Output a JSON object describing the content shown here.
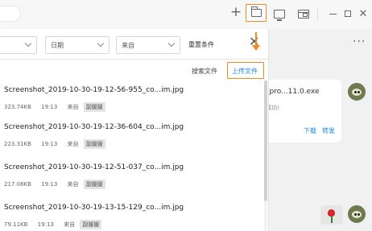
{
  "topbar": {
    "icons": [
      "plus-icon",
      "folder-icon",
      "screen-icon",
      "box-icon",
      "minimize-icon",
      "maximize-icon",
      "close-icon"
    ],
    "plus_glyph": "+",
    "close_glyph": "✕"
  },
  "filters": {
    "first_value": "",
    "date_label": "日期",
    "source_label": "来自",
    "reset_label": "重置条件",
    "close_glyph": "✕"
  },
  "actions": {
    "search_files": "搜索文件",
    "upload_file": "上传文件"
  },
  "files": [
    {
      "name": "Screenshot_2019-10-30-19-12-56-955_co...im.jpg",
      "size": "323.74KB",
      "time": "19:13",
      "from": "来自",
      "tag": "副媛媛"
    },
    {
      "name": "Screenshot_2019-10-30-19-12-36-604_co...im.jpg",
      "size": "223.31KB",
      "time": "19:13",
      "from": "来自",
      "tag": "副媛媛"
    },
    {
      "name": "Screenshot_2019-10-30-19-12-51-037_co...im.jpg",
      "size": "217.08KB",
      "time": "19:13",
      "from": "来自",
      "tag": "副媛媛"
    },
    {
      "name": "Screenshot_2019-10-30-19-13-15-129_co...im.jpg",
      "size": "79.11KB",
      "time": "19:13",
      "from": "来自",
      "tag": "副媛媛"
    }
  ],
  "chat": {
    "more_glyph": "···",
    "file_name": "_pro...11.0.exe",
    "file_status": "成功)",
    "download": "下载",
    "forward": "转发"
  },
  "colors": {
    "highlight": "#f08a23",
    "link": "#1e88e5"
  }
}
